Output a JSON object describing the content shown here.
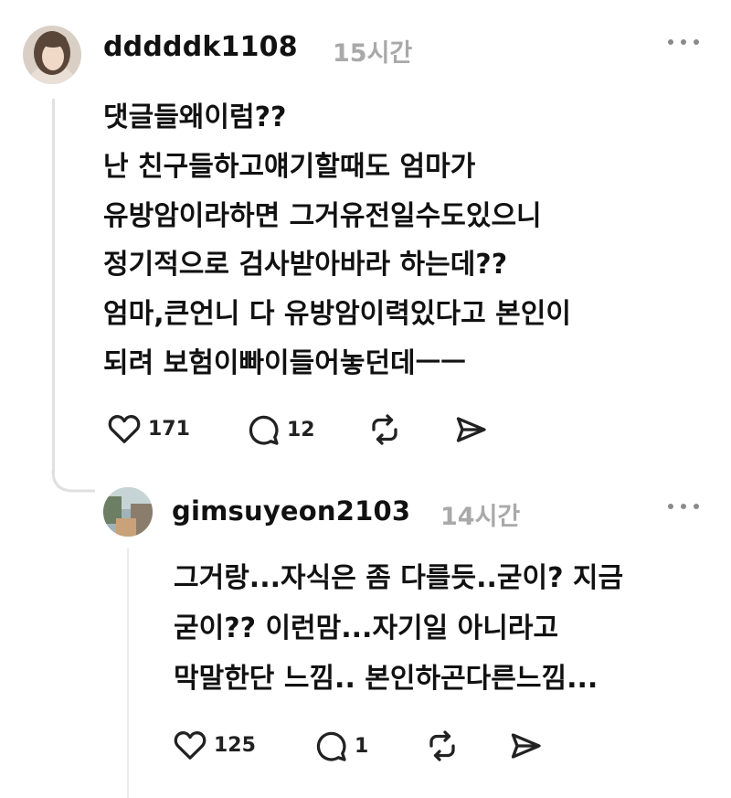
{
  "comments": [
    {
      "username": "dddddk1108",
      "time": "15시간",
      "more_icon": "more-horizontal-icon",
      "lines": [
        "댓글들왜이럼??",
        "난 친구들하고얘기할때도 엄마가",
        "유방암이라하면 그거유전일수도있으니",
        "정기적으로 검사받아바라 하는데??",
        "엄마,큰언니 다 유방암이력있다고 본인이",
        "되려 보험이빠이들어놓던데ㅡㅡ"
      ],
      "likes": "171",
      "replies": "12"
    },
    {
      "username": "gimsuyeon2103",
      "time": "14시간",
      "more_icon": "more-horizontal-icon",
      "lines": [
        "그거랑...자식은 좀 다를듯..굳이? 지금",
        "굳이?? 이런맘...자기일 아니라고",
        "막말한단 느낌.. 본인하곤다른느낌..."
      ],
      "likes": "125",
      "replies": "1"
    }
  ]
}
